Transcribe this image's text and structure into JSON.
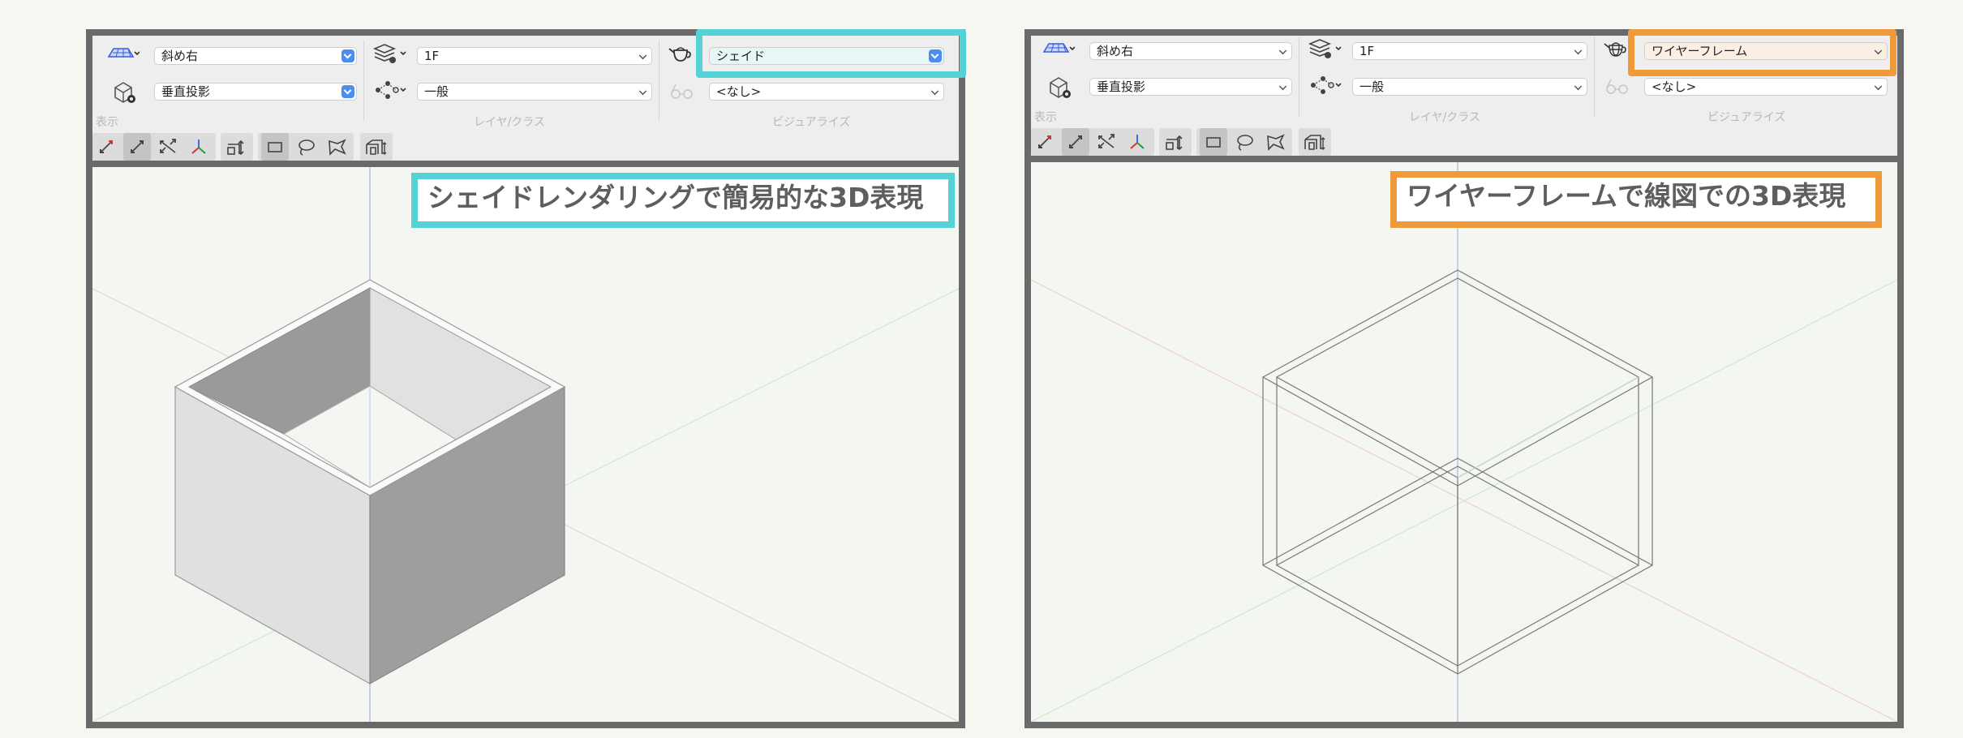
{
  "colors": {
    "left_accent": "#55d2d6",
    "right_accent": "#f09a3a",
    "frame": "#6a6a6a",
    "toolbar": "#eeeeee",
    "canvas": "#f4f7f1"
  },
  "left": {
    "view": "斜め右",
    "projection": "垂直投影",
    "layer": "1F",
    "class": "一般",
    "render_mode": "シェイド",
    "light": "<なし>",
    "section_display": "表示",
    "section_layer": "レイヤ/クラス",
    "section_visualize": "ビジュアライズ",
    "callout": "シェイドレンダリングで簡易的な3D表現"
  },
  "right": {
    "view": "斜め右",
    "projection": "垂直投影",
    "layer": "1F",
    "class": "一般",
    "render_mode": "ワイヤーフレーム",
    "light": "<なし>",
    "section_display": "表示",
    "section_layer": "レイヤ/クラス",
    "section_visualize": "ビジュアライズ",
    "callout": "ワイヤーフレームで線図での3D表現"
  },
  "icons": {
    "view": "view-plane-icon",
    "projection": "cube-gear-icon",
    "layer": "layers-icon",
    "class": "class-nodes-icon",
    "render": "teapot-icon",
    "light": "glasses-icon",
    "tools": [
      "flyover-icon",
      "walkthrough-icon",
      "rotate-view-icon",
      "axis-icon",
      "align-view-icon",
      "rectangle-select-icon",
      "lasso-select-icon",
      "polygon-select-icon",
      "section-view-icon"
    ]
  }
}
